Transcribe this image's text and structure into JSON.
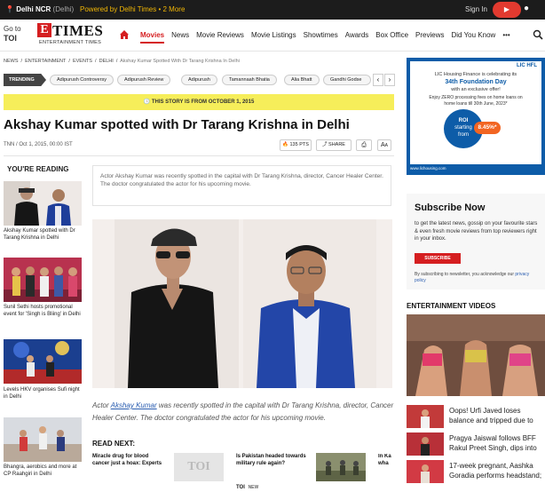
{
  "topbar": {
    "location": "Delhi NCR",
    "location_sub": "(Delhi)",
    "powered": "Powered by Delhi Times • 2 More",
    "signin": "Sign In",
    "app": "▶"
  },
  "header": {
    "goto_line1": "Go to",
    "goto_line2": "TOI",
    "logo_letter": "E",
    "logo_word": "TIMES",
    "logo_sub": "ENTERTAINMENT TIMES"
  },
  "nav": [
    "Movies",
    "News",
    "Movie Reviews",
    "Movie Listings",
    "Showtimes",
    "Awards",
    "Box Office",
    "Previews",
    "Did You Know",
    "•••"
  ],
  "breadcrumb": {
    "items": [
      "NEWS",
      "ENTERTAINMENT",
      "EVENTS",
      "DELHI"
    ],
    "current": "Akshay Kumar Spotted With Dr Tarang Krishna In Delhi"
  },
  "trending": {
    "label": "TRENDING",
    "chips": [
      "Adipurush Controversy",
      "Adipurush Review",
      "Adipurush",
      "Tamannaah Bhatia",
      "Alia Bhatt",
      "Gandhi Godse"
    ]
  },
  "banner": "🕓 THIS STORY IS FROM OCTOBER 1, 2015",
  "article": {
    "title": "Akshay Kumar spotted with Dr Tarang Krishna in Delhi",
    "meta": "TNN / Oct 1, 2015, 00:00 IST",
    "points": "🔥 135 PTS",
    "share": "⤴ SHARE",
    "summary": "Actor Akshay Kumar was recently spotted in the capital with Dr Tarang Krishna, director, Cancer Healer Center. The doctor congratulated the actor for his upcoming movie.",
    "caption_pre": "Actor ",
    "caption_link": "Akshay Kumar",
    "caption_post": " was recently spotted in the capital with Dr Tarang Krishna, director, Cancer Healer Center. The doctor congratulated the actor for his upcoming movie."
  },
  "youre_reading": {
    "heading": "YOU'RE READING",
    "items": [
      {
        "title": "Akshay Kumar spotted with Dr Tarang Krishna in Delhi"
      },
      {
        "title": "Sunil Sethi hosts promotional event for 'Singh is Bliing' in Delhi"
      },
      {
        "title": "Levels HKV organises Sufi night in Delhi"
      },
      {
        "title": "Bhangra, aerobics and more at CP Raahgiri in Delhi"
      }
    ]
  },
  "read_next": {
    "heading": "READ NEXT:",
    "items": [
      {
        "title": "Miracle drug for blood cancer just a hoax: Experts",
        "thumb": "TOI"
      },
      {
        "title": "Is Pakistan headed towards military rule again?"
      },
      {
        "title": "In Ka wha"
      }
    ],
    "bottom_tags": [
      "TOI",
      "NEW"
    ]
  },
  "ad": {
    "brand": "LIC HFL",
    "line1": "LIC Housing Finance is celebrating its",
    "line2": "34th Foundation Day",
    "line3": "with an exclusive offer!",
    "line4": "Enjoy ZERO processing fees on home loans on",
    "line5": "home loans till 30th June, 2023*",
    "roi1": "ROI",
    "roi2": "starting",
    "roi3": "from",
    "rate": "8.45%*",
    "footer": "www.lichousing.com"
  },
  "subscribe": {
    "heading": "Subscribe Now",
    "body": "to get the latest news, gossip on your favourite stars & even fresh movie reviews from top reviewers right in your inbox.",
    "button": "SUBSCRIBE",
    "consent_pre": "By subscribing to newsletter, you acknowledge our ",
    "consent_link": "privacy policy"
  },
  "videos": {
    "heading": "ENTERTAINMENT VIDEOS",
    "items": [
      {
        "title": "Oops! Urfi Javed loses balance and tripped due to"
      },
      {
        "title": "Pragya Jaiswal follows BFF Rakul Preet Singh, dips into"
      },
      {
        "title": "17-week pregnant, Aashka Goradia performs headstand;"
      }
    ]
  },
  "colors": {
    "brand_red": "#d51e20",
    "banner_yellow": "#f6ee5a",
    "ad_blue": "#0d5ca8"
  }
}
